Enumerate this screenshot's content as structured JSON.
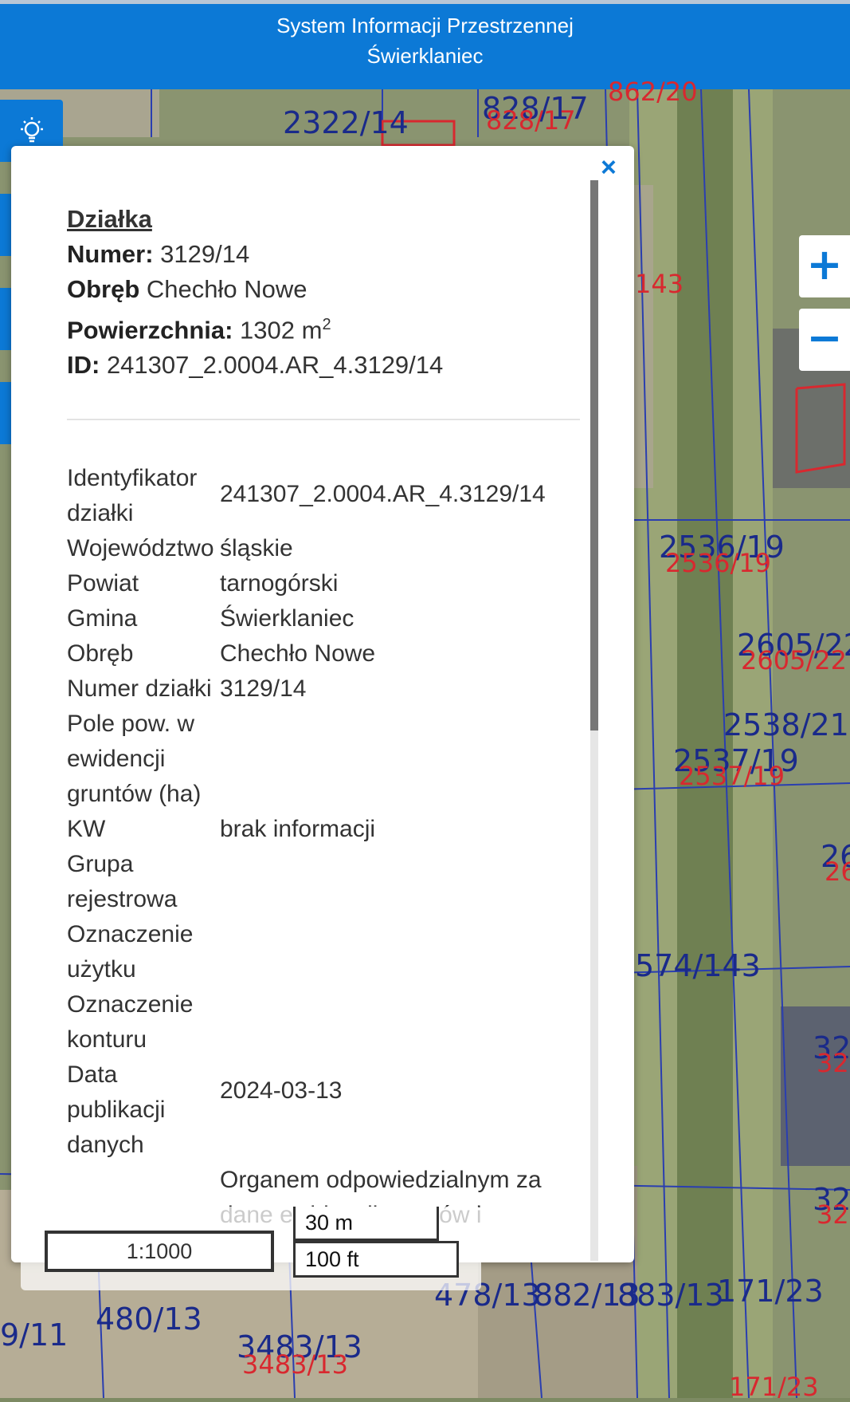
{
  "header": {
    "line1": "System Informacji Przestrzennej",
    "line2": "Świerklaniec"
  },
  "map_labels": [
    "2322/14",
    "828/17",
    "828/17",
    "862/20",
    "143",
    "2536/19",
    "2536/19",
    "2605/22",
    "2605/22",
    "2538/21",
    "2537/19",
    "2537/19",
    "574/143",
    "478/13",
    "882/13",
    "883/13",
    "171/23",
    "480/13",
    "3483/13",
    "3483/13",
    "9/11",
    "171/23",
    "26",
    "26",
    "32",
    "32",
    "32",
    "32"
  ],
  "zoom": {
    "in_label": "+",
    "out_label": "−"
  },
  "popup": {
    "close_label": "×",
    "title": "Działka",
    "numer_key": "Numer:",
    "numer_val": " 3129/14",
    "obreb_key": "Obręb",
    "obreb_val": " Chechło Nowe",
    "pow_key": "Powierzchnia:",
    "pow_val": " 1302 m",
    "pow_sup": "2",
    "id_key": "ID:",
    "id_val": " 241307_2.0004.AR_4.3129/14",
    "rows": [
      {
        "k": "Identyfikator działki",
        "v": "241307_2.0004.AR_4.3129/14"
      },
      {
        "k": "Województwo",
        "v": "śląskie"
      },
      {
        "k": "Powiat",
        "v": "tarnogórski"
      },
      {
        "k": "Gmina",
        "v": "Świerklaniec"
      },
      {
        "k": "Obręb",
        "v": "Chechło Nowe"
      },
      {
        "k": "Numer działki",
        "v": "3129/14"
      },
      {
        "k": "Pole pow. w ewidencji gruntów (ha)",
        "v": ""
      },
      {
        "k": "KW",
        "v": "brak informacji"
      },
      {
        "k": "Grupa rejestrowa",
        "v": ""
      },
      {
        "k": "Oznaczenie użytku",
        "v": ""
      },
      {
        "k": "Oznaczenie konturu",
        "v": ""
      },
      {
        "k": "Data publikacji danych",
        "v": "2024-03-13"
      },
      {
        "k": "",
        "v": "Organem odpowiedzialnym za dane ewidencji gruntów i"
      }
    ]
  },
  "scale": {
    "ratio": "1:1000",
    "metric": "30 m",
    "imperial": "100 ft"
  }
}
